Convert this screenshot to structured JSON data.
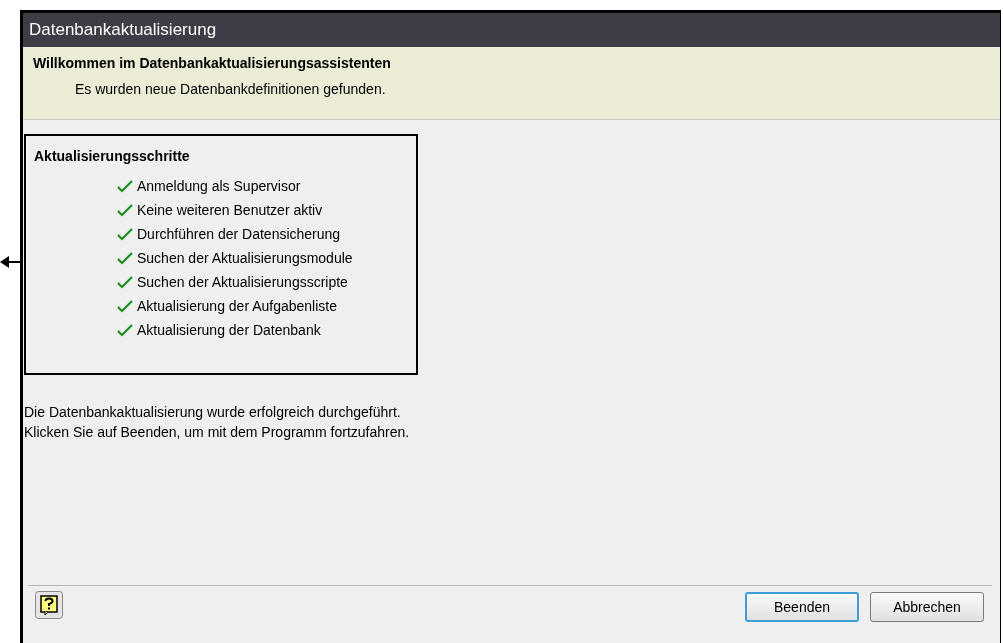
{
  "window": {
    "title": "Datenbankaktualisierung"
  },
  "header": {
    "title": "Willkommen im Datenbankaktualisierungsassistenten",
    "subtitle": "Es wurden neue Datenbankdefinitionen gefunden."
  },
  "steps": {
    "title": "Aktualisierungsschritte",
    "items": [
      {
        "label": "Anmeldung als Supervisor",
        "done": true
      },
      {
        "label": "Keine weiteren Benutzer aktiv",
        "done": true
      },
      {
        "label": "Durchführen der Datensicherung",
        "done": true
      },
      {
        "label": "Suchen der Aktualisierungsmodule",
        "done": true
      },
      {
        "label": "Suchen der Aktualisierungsscripte",
        "done": true
      },
      {
        "label": "Aktualisierung der Aufgabenliste",
        "done": true
      },
      {
        "label": "Aktualisierung der Datenbank",
        "done": true
      }
    ]
  },
  "message": [
    "Die Datenbankaktualisierung wurde erfolgreich durchgeführt.",
    "Klicken Sie auf Beenden, um mit dem Programm fortzufahren."
  ],
  "buttons": [
    {
      "label": "Beenden",
      "default": true
    },
    {
      "label": "Abbrechen",
      "default": false
    }
  ]
}
